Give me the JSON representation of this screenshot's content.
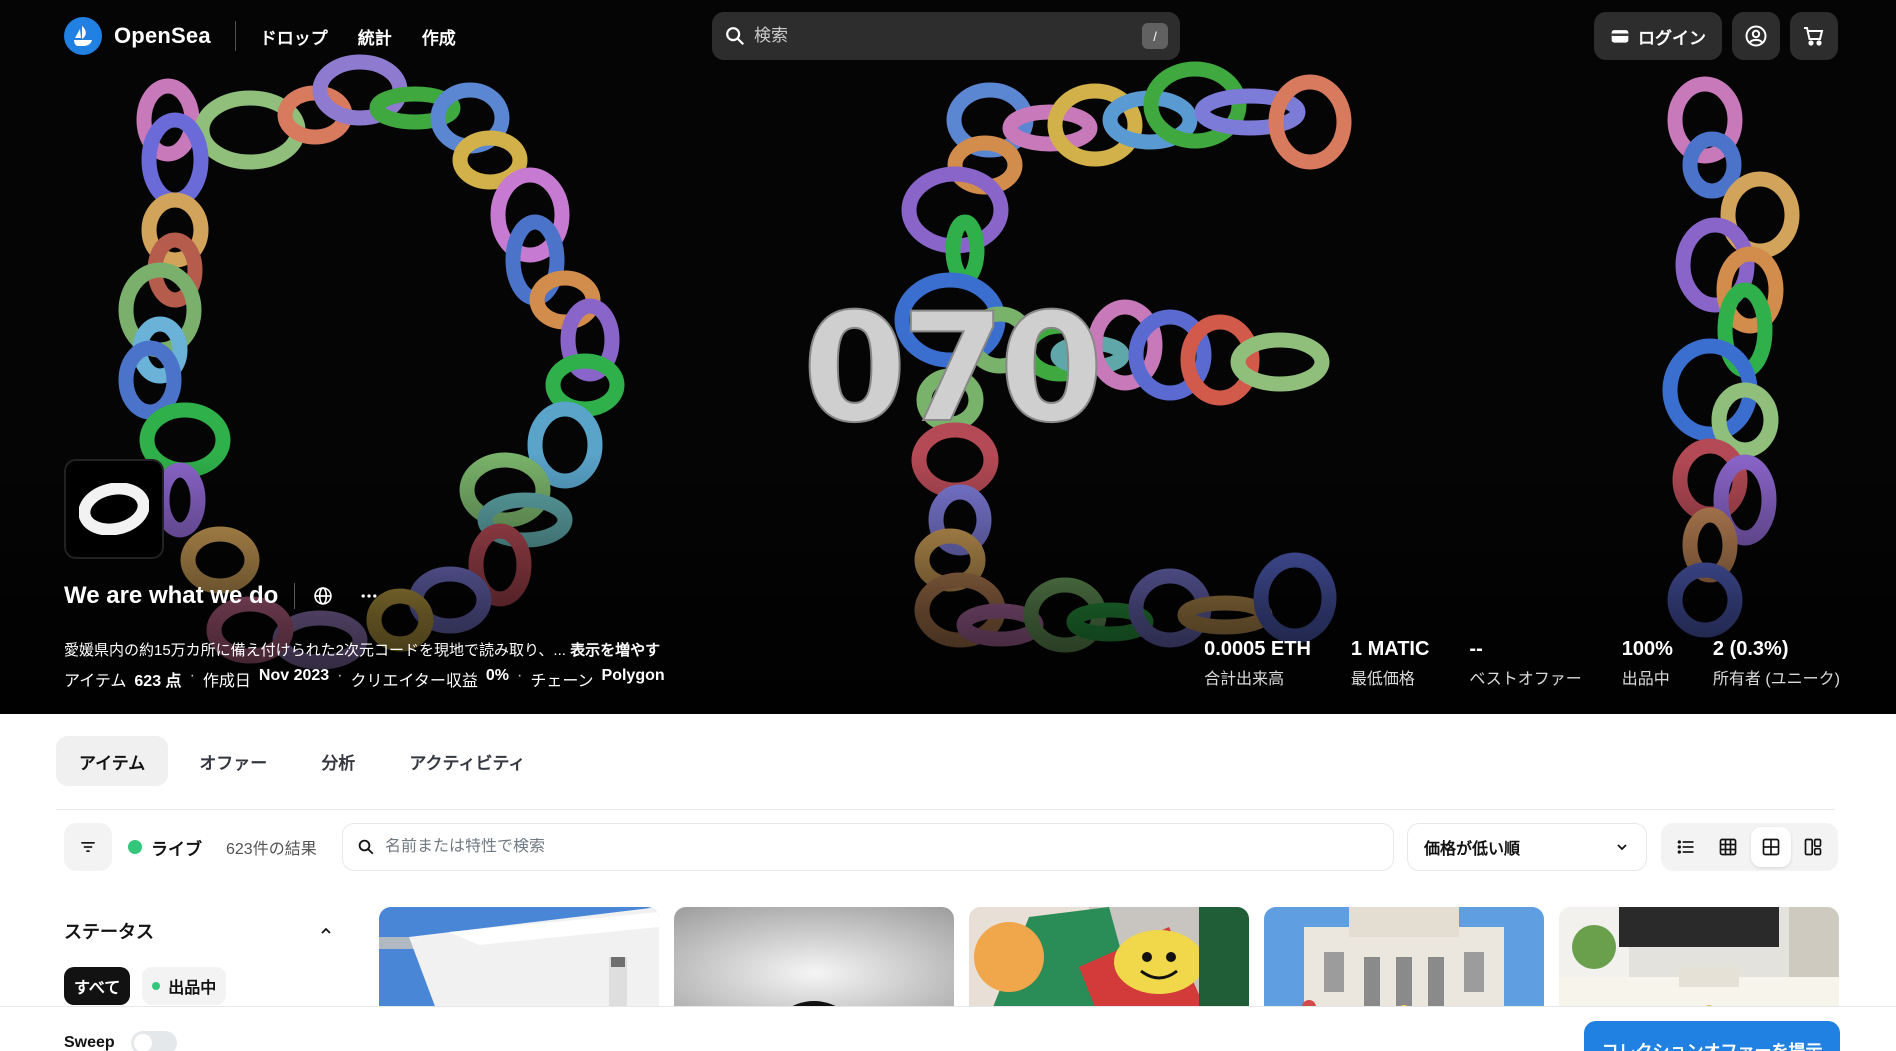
{
  "nav": {
    "brand": "OpenSea",
    "links": [
      "ドロップ",
      "統計",
      "作成"
    ],
    "search_placeholder": "検索",
    "search_shortcut": "/",
    "login": "ログイン"
  },
  "hero": {
    "art_text": "070"
  },
  "collection": {
    "title": "We are what we do",
    "description": "愛媛県内の約15万カ所に備え付けられた2次元コードを現地で読み取り、...",
    "show_more": "表示を増やす",
    "meta": {
      "items_label": "アイテム",
      "items_value": "623 点",
      "created_label": "作成日",
      "created_value": "Nov 2023",
      "royalty_label": "クリエイター収益",
      "royalty_value": "0%",
      "chain_label": "チェーン",
      "chain_value": "Polygon"
    },
    "stats": [
      {
        "value": "0.0005 ETH",
        "label": "合計出来高"
      },
      {
        "value": "1 MATIC",
        "label": "最低価格"
      },
      {
        "value": "--",
        "label": "ベストオファー"
      },
      {
        "value": "100%",
        "label": "出品中"
      },
      {
        "value": "2 (0.3%)",
        "label": "所有者 (ユニーク)"
      }
    ]
  },
  "tabs": [
    "アイテム",
    "オファー",
    "分析",
    "アクティビティ"
  ],
  "toolbar": {
    "live_label": "ライブ",
    "results": "623件の結果",
    "search_placeholder": "名前または特性で検索",
    "sort_value": "価格が低い順"
  },
  "sidebar": {
    "status_heading": "ステータス",
    "chips": [
      "すべて",
      "出品中"
    ]
  },
  "bottom": {
    "sweep_label": "Sweep",
    "offer_button": "コレクションオファーを提示"
  },
  "colors": {
    "accent": "#2081e2",
    "live_green": "#34c77b"
  }
}
